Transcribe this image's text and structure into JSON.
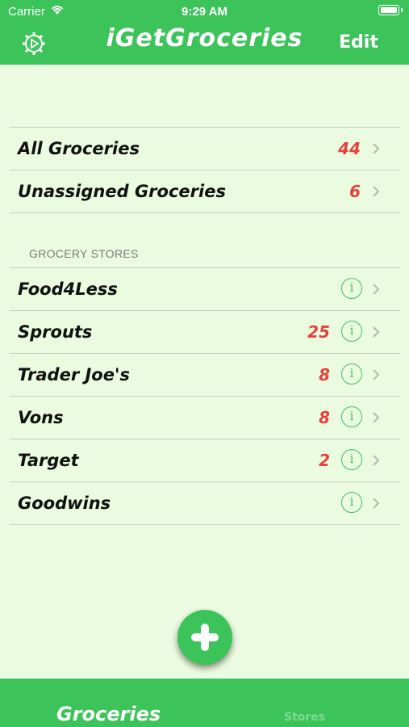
{
  "status_bar": {
    "carrier": "Carrier",
    "time": "9:29 AM"
  },
  "nav": {
    "title": "iGetGroceries",
    "edit_label": "Edit",
    "left_icon": "gear-icon"
  },
  "summary": [
    {
      "label": "All Groceries",
      "count": "44"
    },
    {
      "label": "Unassigned Groceries",
      "count": "6"
    }
  ],
  "stores_section": {
    "header": "GROCERY STORES",
    "items": [
      {
        "label": "Food4Less",
        "count": ""
      },
      {
        "label": "Sprouts",
        "count": "25"
      },
      {
        "label": "Trader Joe's",
        "count": "8"
      },
      {
        "label": "Vons",
        "count": "8"
      },
      {
        "label": "Target",
        "count": "2"
      },
      {
        "label": "Goodwins",
        "count": ""
      }
    ]
  },
  "tabs": {
    "groceries": "Groceries",
    "second": "Stores"
  },
  "colors": {
    "accent": "#3cc45a",
    "background": "#ebfbe0",
    "count": "#e8403c"
  }
}
